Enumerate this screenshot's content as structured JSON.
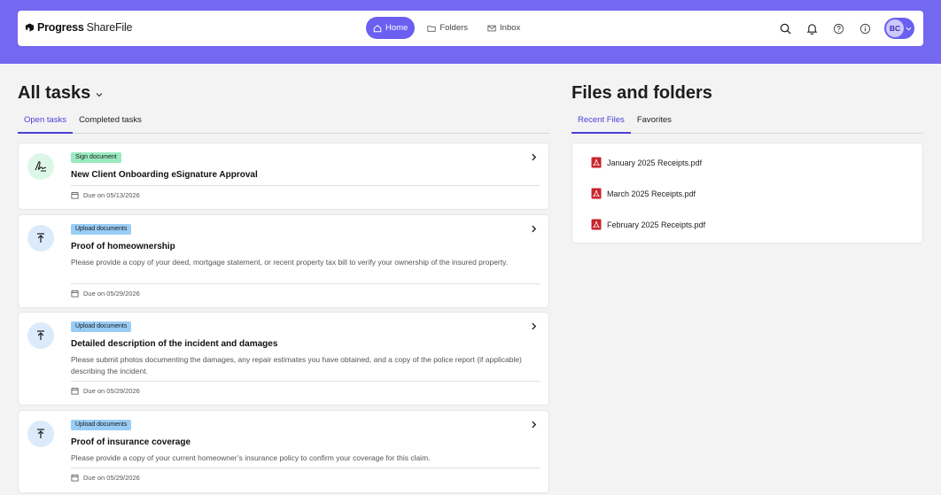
{
  "header": {
    "logo_progress": "Progress",
    "logo_sharefile": "ShareFile",
    "nav": [
      {
        "label": "Home",
        "icon": "home-icon",
        "active": true
      },
      {
        "label": "Folders",
        "icon": "folder-icon",
        "active": false
      },
      {
        "label": "Inbox",
        "icon": "mail-icon",
        "active": false
      }
    ],
    "avatar_initials": "BC",
    "accent_color": "#6a5ff0",
    "band_color": "#7467f0"
  },
  "tasks": {
    "title": "All tasks",
    "tabs": [
      {
        "label": "Open tasks",
        "active": true
      },
      {
        "label": "Completed tasks",
        "active": false
      }
    ],
    "items": [
      {
        "badge": "Sign document",
        "icon": "signature-icon",
        "title": "New Client Onboarding eSignature Approval",
        "description": "",
        "due": "Due on 05/13/2026"
      },
      {
        "badge": "Upload documents",
        "icon": "upload-icon",
        "title": "Proof of homeownership",
        "description": "Please provide a copy of your deed, mortgage statement, or recent property tax bill to verify your ownership of the insured property.",
        "due": "Due on 05/29/2026"
      },
      {
        "badge": "Upload documents",
        "icon": "upload-icon",
        "title": "Detailed description of the incident and damages",
        "description": "Please submit photos documenting the damages, any repair estimates you have obtained, and a copy of the police report (if applicable) describing the incident.",
        "due": "Due on 05/29/2026"
      },
      {
        "badge": "Upload documents",
        "icon": "upload-icon",
        "title": "Proof of insurance coverage",
        "description": "Please provide a copy of your current homeowner’s insurance policy to confirm your coverage for this claim.",
        "due": "Due on 05/29/2026"
      }
    ]
  },
  "files": {
    "title": "Files and folders",
    "tabs": [
      {
        "label": "Recent Files",
        "active": true
      },
      {
        "label": "Favorites",
        "active": false
      }
    ],
    "items": [
      {
        "name": "January 2025 Receipts.pdf",
        "icon": "pdf-icon"
      },
      {
        "name": "March 2025 Receipts.pdf",
        "icon": "pdf-icon"
      },
      {
        "name": "February 2025 Receipts.pdf",
        "icon": "pdf-icon"
      }
    ]
  }
}
